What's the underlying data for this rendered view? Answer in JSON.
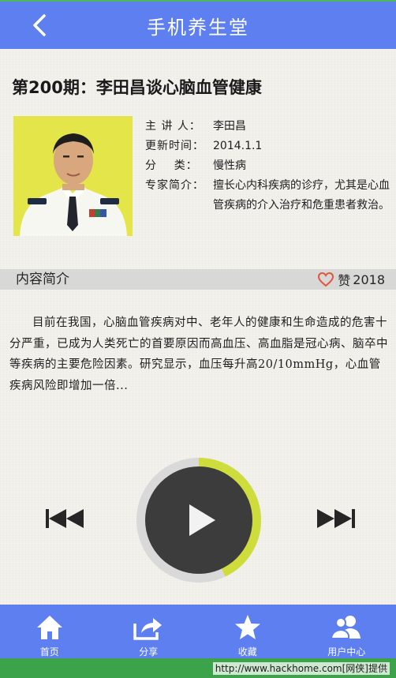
{
  "header": {
    "title": "手机养生堂",
    "back_icon": "back-chevron-icon"
  },
  "episode": {
    "title": "第200期：李田昌谈心脑血管健康",
    "speaker_label": "主 讲 人：",
    "speaker": "李田昌",
    "updated_label": "更新时间：",
    "updated": "2014.1.1",
    "category_label": "分    类：",
    "category": "慢性病",
    "expert_label": "专家简介：",
    "expert_bio": "擅长心内科疾病的诊疗，尤其是心血管疾病的介入治疗和危重患者救治。"
  },
  "intro": {
    "label": "内容简介",
    "like_icon": "heart-icon",
    "like_label": "赞",
    "like_count": "2018"
  },
  "summary": "目前在我国，心脑血管疾病对中、老年人的健康和生命造成的危害十分严重，已成为人类死亡的首要原因而高血压、高血脂是冠心病、脑卒中等疾病的主要危险因素。研究显示，血压每升高20/10mmHg，心血管疾病风险即增加一倍...",
  "player": {
    "progress": 0.43,
    "accent_color": "#cfdd3c",
    "track_color": "#d9d9d9"
  },
  "tabs": [
    {
      "label": "首页",
      "icon": "home-icon"
    },
    {
      "label": "分享",
      "icon": "share-icon"
    },
    {
      "label": "收藏",
      "icon": "star-icon"
    },
    {
      "label": "用户中心",
      "icon": "users-icon"
    }
  ],
  "watermark": "http://www.hackhome.com[网侠]提供",
  "colors": {
    "header": "#5d7ff0",
    "footer": "#3ca34a",
    "heart": "#e2553e"
  }
}
